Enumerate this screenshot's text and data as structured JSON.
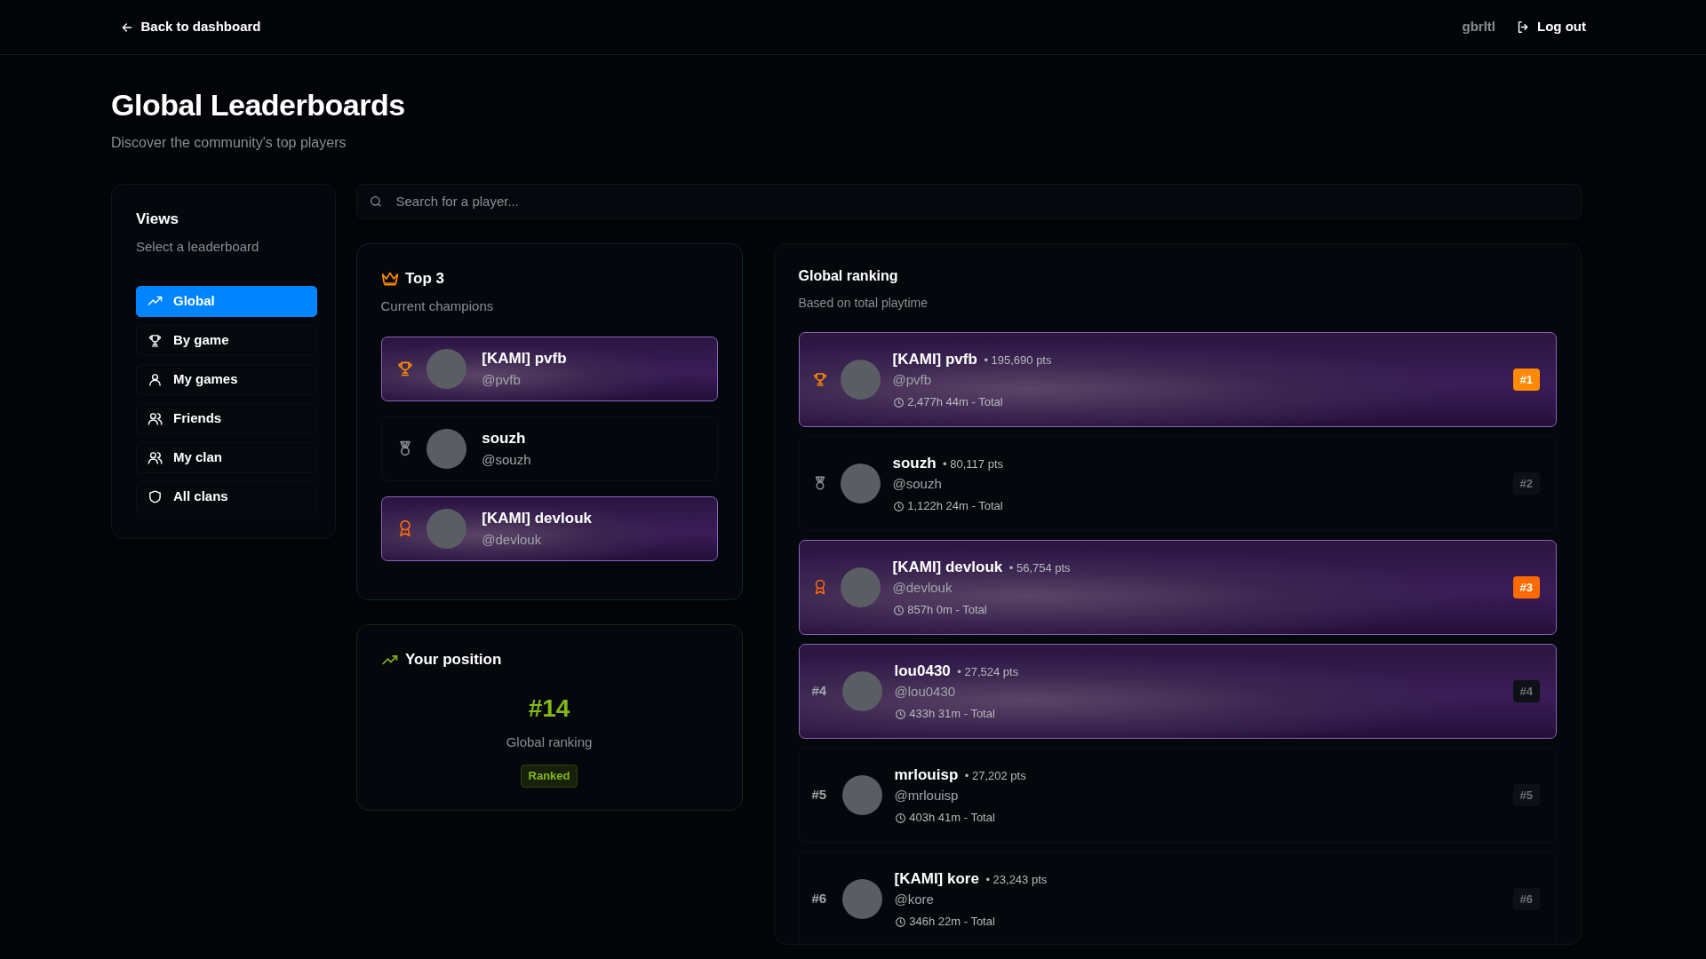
{
  "header": {
    "back_link": "Back to dashboard",
    "username": "gbrltl",
    "logout": "Log out"
  },
  "page": {
    "title": "Global Leaderboards",
    "subtitle": "Discover the community's top players"
  },
  "views": {
    "title": "Views",
    "subtitle": "Select a leaderboard",
    "items": [
      {
        "label": "Global",
        "selected": true
      },
      {
        "label": "By game",
        "selected": false
      },
      {
        "label": "My games",
        "selected": false
      },
      {
        "label": "Friends",
        "selected": false
      },
      {
        "label": "My clan",
        "selected": false
      },
      {
        "label": "All clans",
        "selected": false
      }
    ]
  },
  "search": {
    "placeholder": "Search for a player..."
  },
  "top3": {
    "title": "Top 3",
    "subtitle": "Current champions",
    "players": [
      {
        "kind": "trophy",
        "banner": true,
        "name": "[KAMI] pvfb",
        "handle": "@pvfb"
      },
      {
        "kind": "medal",
        "banner": false,
        "name": "souzh",
        "handle": "@souzh"
      },
      {
        "kind": "award",
        "banner": true,
        "name": "[KAMI] devlouk",
        "handle": "@devlouk"
      }
    ]
  },
  "position": {
    "title": "Your position",
    "rank": "#14",
    "label": "Global ranking",
    "status": "Ranked"
  },
  "ranking": {
    "title": "Global ranking",
    "subtitle": "Based on total playtime",
    "rows": [
      {
        "kind": "trophy",
        "banner": true,
        "name": "[KAMI] pvfb",
        "points": "• 195,690 pts",
        "handle": "@pvfb",
        "time": "2,477h 44m - Total",
        "badge": "#1",
        "color": "#ff8a00"
      },
      {
        "kind": "medal",
        "banner": false,
        "name": "souzh",
        "points": "• 80,117 pts",
        "handle": "@souzh",
        "time": "1,122h 24m - Total",
        "badge": "#2"
      },
      {
        "kind": "award",
        "banner": true,
        "name": "[KAMI] devlouk",
        "points": "• 56,754 pts",
        "handle": "@devlouk",
        "time": "857h 0m - Total",
        "badge": "#3",
        "color": "#ff6a00"
      },
      {
        "kind": "rank",
        "rank": "#4",
        "banner": true,
        "name": "lou0430",
        "points": "• 27,524 pts",
        "handle": "@lou0430",
        "time": "433h 31m - Total",
        "badge": "#4"
      },
      {
        "kind": "rank",
        "rank": "#5",
        "banner": false,
        "name": "mrlouisp",
        "points": "• 27,202 pts",
        "handle": "@mrlouisp",
        "time": "403h 41m - Total",
        "badge": "#5"
      },
      {
        "kind": "rank",
        "rank": "#6",
        "banner": false,
        "name": "[KAMI] kore",
        "points": "• 23,243 pts",
        "handle": "@kore",
        "time": "346h 22m - Total",
        "badge": "#6"
      }
    ]
  }
}
